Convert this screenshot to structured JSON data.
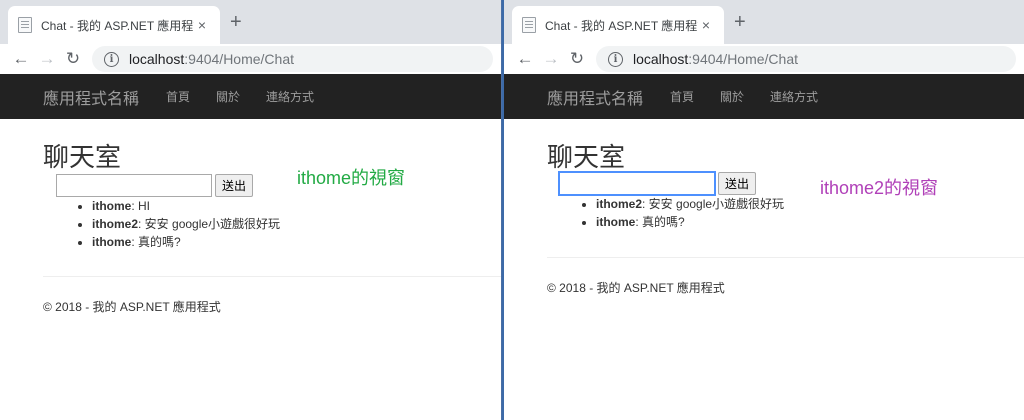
{
  "left": {
    "tab_title": "Chat - 我的 ASP.NET 應用程式",
    "url_host": "localhost",
    "url_path": ":9404/Home/Chat",
    "brand": "應用程式名稱",
    "nav": [
      "首頁",
      "關於",
      "連絡方式"
    ],
    "page_title": "聊天室",
    "input_value": "",
    "send_label": "送出",
    "messages": [
      {
        "user": "ithome",
        "text": ": HI"
      },
      {
        "user": "ithome2",
        "text": ": 安安 google小遊戲很好玩"
      },
      {
        "user": "ithome",
        "text": ": 真的嗎?"
      }
    ],
    "footer": "© 2018 - 我的 ASP.NET 應用程式",
    "annotation": "ithome的視窗",
    "annotation_color": "#22aa44"
  },
  "right": {
    "tab_title": "Chat - 我的 ASP.NET 應用程式",
    "url_host": "localhost",
    "url_path": ":9404/Home/Chat",
    "brand": "應用程式名稱",
    "nav": [
      "首頁",
      "關於",
      "連絡方式"
    ],
    "page_title": "聊天室",
    "input_value": "",
    "send_label": "送出",
    "messages": [
      {
        "user": "ithome2",
        "text": ": 安安 google小遊戲很好玩"
      },
      {
        "user": "ithome",
        "text": ": 真的嗎?"
      }
    ],
    "footer": "© 2018 - 我的 ASP.NET 應用程式",
    "annotation": "ithome2的視窗",
    "annotation_color": "#b040b8"
  },
  "icons": {
    "close": "×",
    "new_tab": "+",
    "back": "←",
    "forward": "→",
    "reload": "↻",
    "info": "i"
  }
}
